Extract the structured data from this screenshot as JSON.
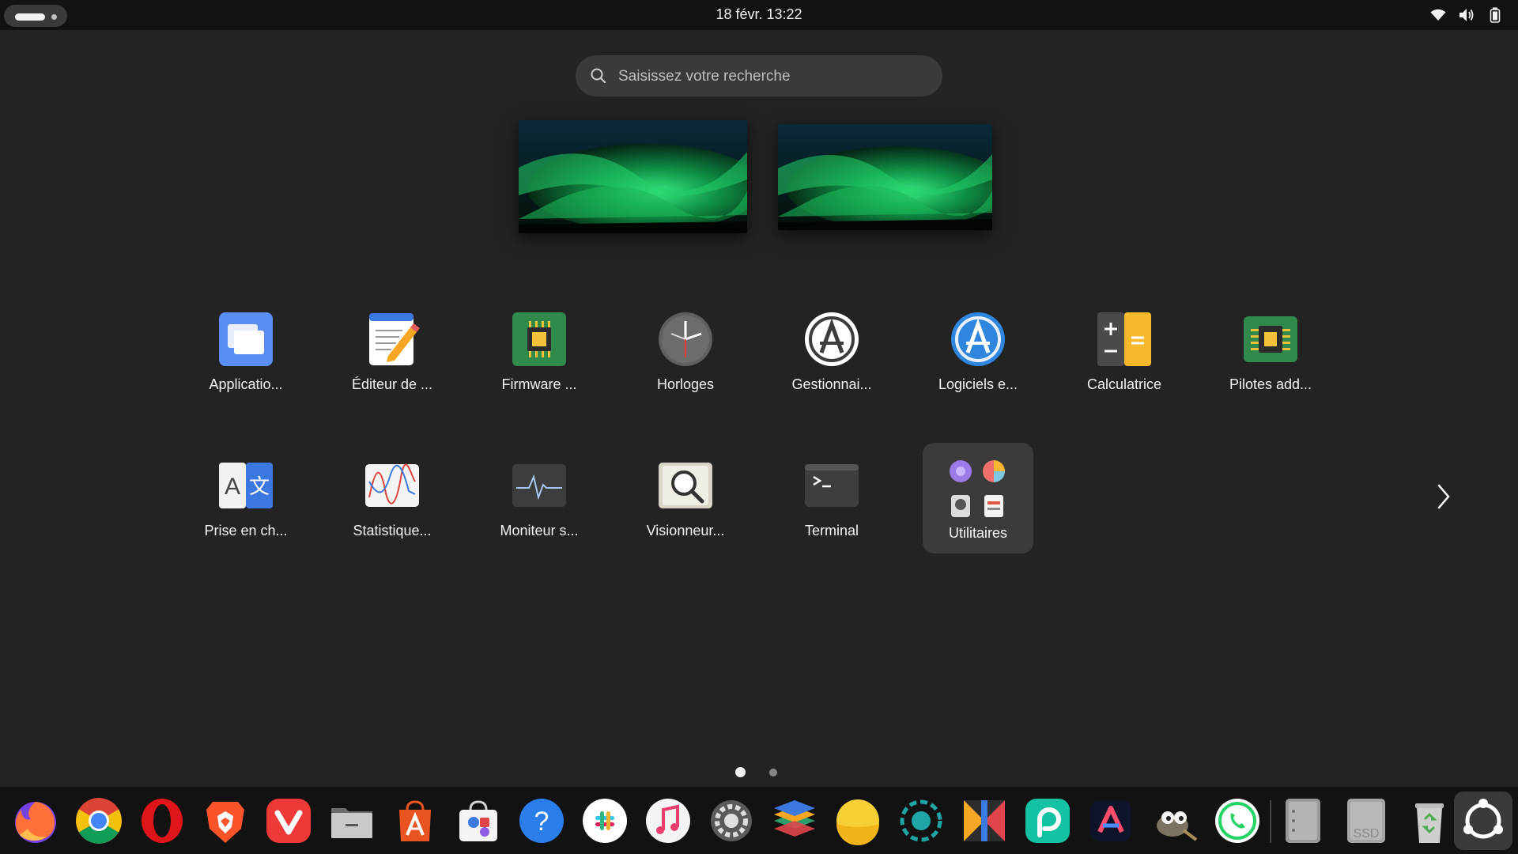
{
  "topbar": {
    "datetime": "18 févr.  13:22",
    "tray_icons": [
      "wifi-icon",
      "volume-icon",
      "battery-icon"
    ]
  },
  "search": {
    "placeholder": "Saisissez votre recherche"
  },
  "workspaces": [
    "workspace-1",
    "workspace-2"
  ],
  "apps": [
    {
      "label": "Applicatio...",
      "icon": "applications-icon"
    },
    {
      "label": "Éditeur de ...",
      "icon": "text-editor-icon"
    },
    {
      "label": "Firmware ...",
      "icon": "firmware-icon"
    },
    {
      "label": "Horloges",
      "icon": "clocks-icon"
    },
    {
      "label": "Gestionnai...",
      "icon": "software-manager-icon"
    },
    {
      "label": "Logiciels e...",
      "icon": "software-updates-icon"
    },
    {
      "label": "Calculatrice",
      "icon": "calculator-icon"
    },
    {
      "label": "Pilotes add...",
      "icon": "additional-drivers-icon"
    },
    {
      "label": "Prise en ch...",
      "icon": "language-support-icon"
    },
    {
      "label": "Statistique...",
      "icon": "power-statistics-icon"
    },
    {
      "label": "Moniteur s...",
      "icon": "system-monitor-icon"
    },
    {
      "label": "Visionneur...",
      "icon": "log-viewer-icon"
    },
    {
      "label": "Terminal",
      "icon": "terminal-icon"
    },
    {
      "label": "Utilitaires",
      "icon": "utilities-folder-icon"
    }
  ],
  "pagination": {
    "pages": 2,
    "current": 1
  },
  "dock": [
    "firefox-icon",
    "chrome-icon",
    "opera-icon",
    "brave-icon",
    "vivaldi-icon",
    "files-icon",
    "app-center-icon",
    "software-store-icon",
    "help-icon",
    "slack-icon",
    "music-icon",
    "settings-icon",
    "layers-icon",
    "weather-icon",
    "screen-recorder-icon",
    "kdenlive-icon",
    "picsart-icon",
    "arc-icon",
    "gimp-icon",
    "whatsapp-icon",
    "drive-icon",
    "ssd-drive-icon",
    "trash-icon",
    "show-apps-icon"
  ],
  "dock_ssd_label": "SSD",
  "colors": {
    "background": "#232323",
    "topbar": "#121212",
    "accent": "#e95420"
  }
}
